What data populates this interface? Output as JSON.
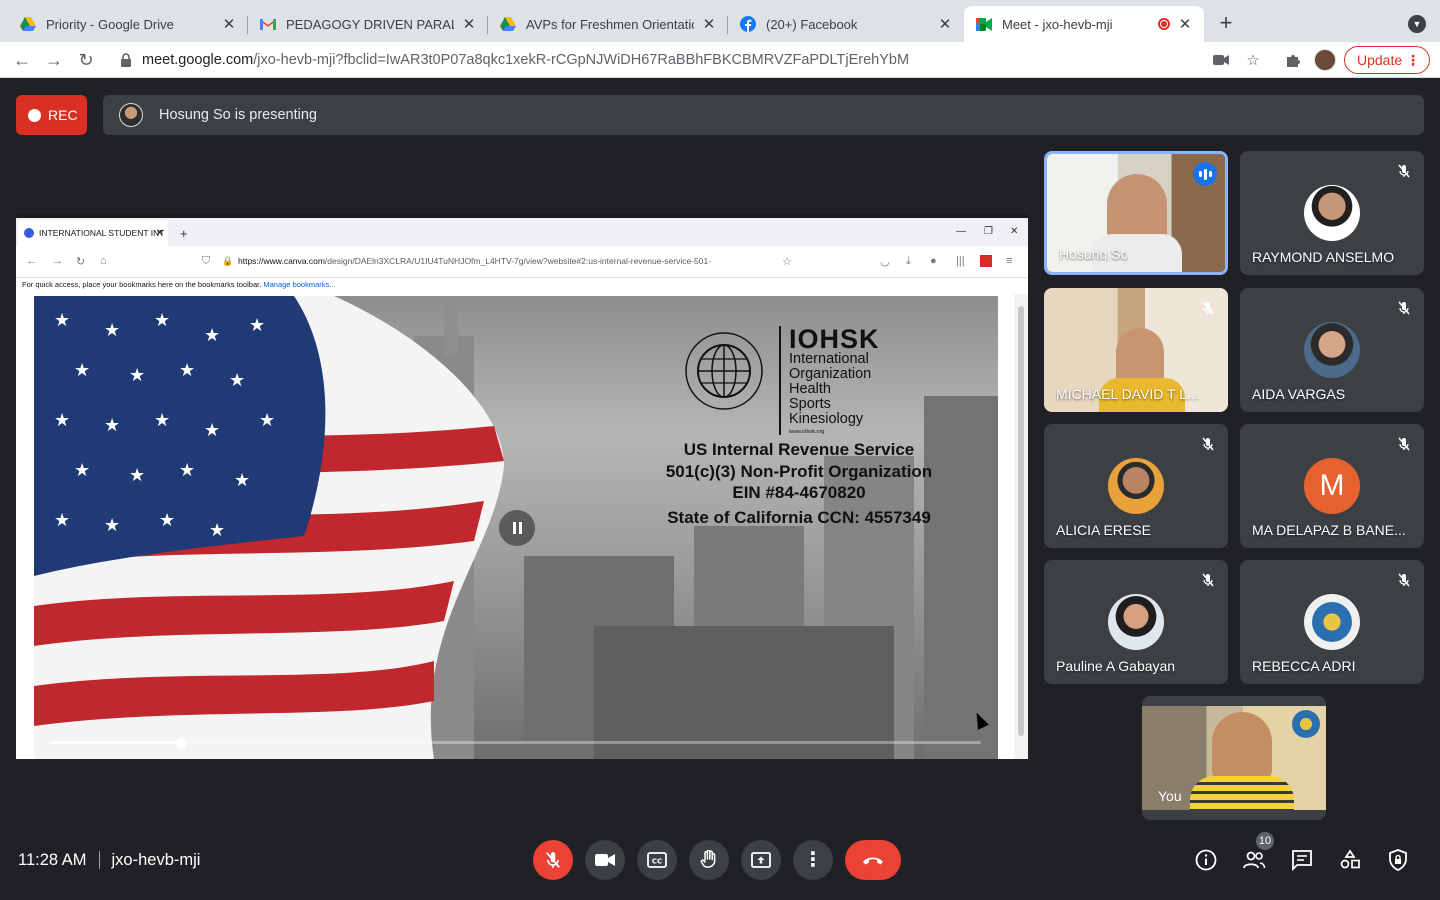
{
  "browser": {
    "tabs": [
      {
        "title": "Priority - Google Drive",
        "icon": "google-drive-icon"
      },
      {
        "title": "PEDAGOGY DRIVEN PARALLEL",
        "icon": "gmail-icon"
      },
      {
        "title": "AVPs for Freshmen Orientation",
        "icon": "google-drive-icon"
      },
      {
        "title": "(20+) Facebook",
        "icon": "facebook-icon"
      },
      {
        "title": "Meet - jxo-hevb-mji",
        "icon": "google-meet-icon"
      }
    ],
    "url_host": "meet.google.com",
    "url_path": "/jxo-hevb-mji?fbclid=IwAR3t0P07a8qkc1xekR-rCGpNJWiDH67RaBBhFBKCBMRVZFaPDLTjErehYbM",
    "update_label": "Update"
  },
  "meet": {
    "rec_label": "REC",
    "presenting_text": "Hosung So is presenting",
    "time": "11:28 AM",
    "meeting_code": "jxo-hevb-mji",
    "participant_count": "10",
    "colors": {
      "accent_red": "#ea4335",
      "tile_bg": "#3c4043",
      "speaking_border": "#8ab4f8",
      "background": "#202124"
    }
  },
  "shared_screen": {
    "tab_title": "INTERNATIONAL STUDENT INT",
    "url_host": "https://www.canva.com",
    "url_path": "/design/DAEln3XCLRA/U1IU4TuNHJOfm_L4HTV-7g/view?website#2:us-internal-revenue-service-501-",
    "bookmarks_text": "For quick access, place your bookmarks here on the bookmarks toolbar.",
    "bookmarks_link": "Manage bookmarks...",
    "logo_title": "IOHSK",
    "logo_lines": [
      "International",
      "Organization",
      "Health",
      "Sports",
      "Kinesiology"
    ],
    "logo_url": "www.iohsk.org",
    "slide_lines": [
      "US Internal Revenue Service",
      "501(c)(3) Non-Profit Organization",
      "EIN #84-4670820",
      "State of California CCN: 4557349"
    ],
    "video_progress": 0.14
  },
  "participants": [
    {
      "name": "Hosung So",
      "muted": false,
      "speaking": true,
      "kind": "video"
    },
    {
      "name": "RAYMOND ANSELMO",
      "muted": true,
      "kind": "avatar"
    },
    {
      "name": "MICHAEL DAVID T L...",
      "muted": true,
      "kind": "video"
    },
    {
      "name": "AIDA VARGAS",
      "muted": true,
      "kind": "avatar"
    },
    {
      "name": "ALICIA ERESE",
      "muted": true,
      "kind": "avatar"
    },
    {
      "name": "MA DELAPAZ B BANE...",
      "muted": true,
      "kind": "letter",
      "letter": "M"
    },
    {
      "name": "Pauline A Gabayan",
      "muted": true,
      "kind": "avatar"
    },
    {
      "name": "REBECCA ADRI",
      "muted": true,
      "kind": "avatar"
    }
  ],
  "self": {
    "name": "You"
  }
}
